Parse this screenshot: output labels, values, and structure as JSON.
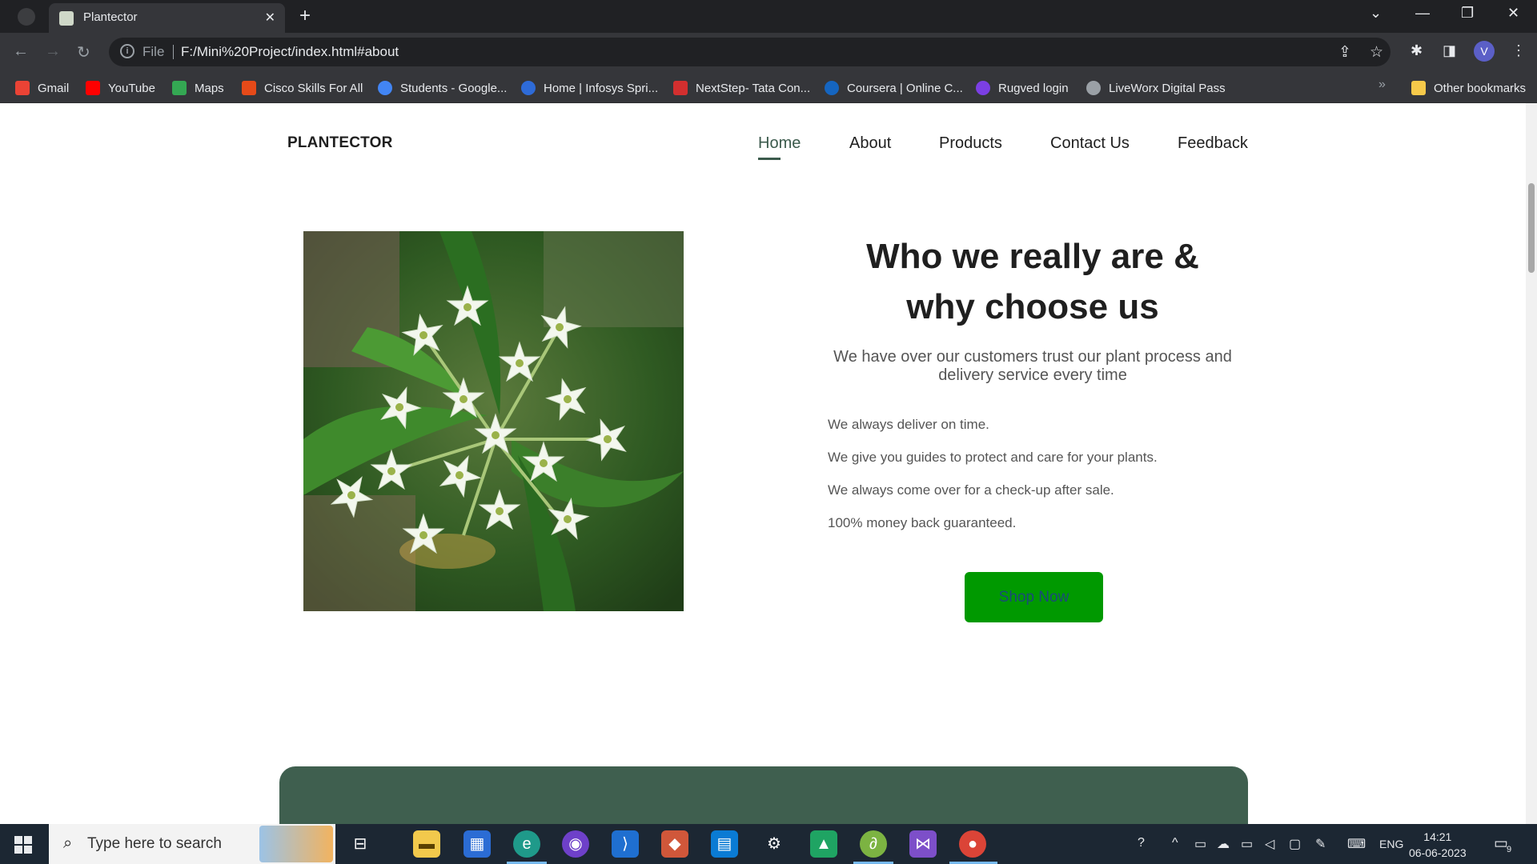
{
  "browser": {
    "tab_title": "Plantector",
    "url_scheme_label": "File",
    "url": "F:/Mini%20Project/index.html#about",
    "profile_initial": "V",
    "bookmarks": [
      {
        "label": "Gmail",
        "color": "#ea4335"
      },
      {
        "label": "YouTube",
        "color": "#ff0000"
      },
      {
        "label": "Maps",
        "color": "#34a853"
      },
      {
        "label": "Cisco Skills For All",
        "color": "#e64a19"
      },
      {
        "label": "Students - Google...",
        "color": "#4285f4"
      },
      {
        "label": "Home | Infosys Spri...",
        "color": "#2e6bd8"
      },
      {
        "label": "NextStep- Tata Con...",
        "color": "#d32f2f"
      },
      {
        "label": "Coursera | Online C...",
        "color": "#1565c0"
      },
      {
        "label": "Rugved login",
        "color": "#7b3fe4"
      },
      {
        "label": "LiveWorx Digital Pass",
        "color": "#9aa0a6"
      }
    ],
    "other_bookmarks": "Other bookmarks"
  },
  "site": {
    "brand": "PLANTECTOR",
    "nav": [
      "Home",
      "About",
      "Products",
      "Contact Us",
      "Feedback"
    ],
    "active_nav": "Home",
    "about": {
      "title_line1": "Who we really are &",
      "title_line2": "why choose us",
      "subtitle_line1": "We have over our customers trust our plant process and",
      "subtitle_line2": "delivery service every time",
      "points": [
        "We always deliver on time.",
        "We give you guides to protect and care for your plants.",
        "We always come over for a check-up after sale.",
        "100% money back guaranteed."
      ],
      "button": "Shop Now"
    },
    "colors": {
      "accent_green": "#009900",
      "panel_green": "#3f5f4f",
      "nav_active": "#3b5a4c"
    }
  },
  "taskbar": {
    "search_placeholder": "Type here to search",
    "language": "ENG",
    "time": "14:21",
    "date": "06-06-2023",
    "notification_count": "9"
  }
}
